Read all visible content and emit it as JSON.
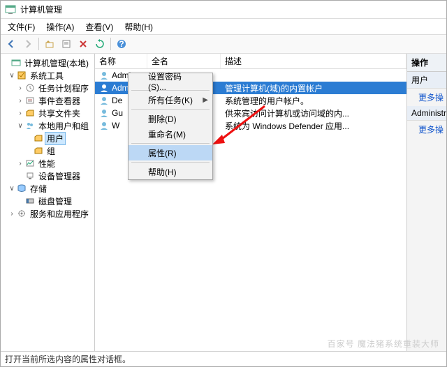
{
  "title": "计算机管理",
  "menus": {
    "file": "文件(F)",
    "action": "操作(A)",
    "view": "查看(V)",
    "help": "帮助(H)"
  },
  "tree": {
    "root": "计算机管理(本地)",
    "systools": "系统工具",
    "scheduler": "任务计划程序",
    "eventviewer": "事件查看器",
    "shared": "共享文件夹",
    "localusers": "本地用户和组",
    "users": "用户",
    "groups": "组",
    "perf": "性能",
    "devmgr": "设备管理器",
    "storage": "存储",
    "diskmgmt": "磁盘管理",
    "services": "服务和应用程序"
  },
  "columns": {
    "name": "名称",
    "fullname": "全名",
    "desc": "描述"
  },
  "colw": {
    "name": 75,
    "fullname": 105,
    "desc": 260
  },
  "users": [
    {
      "name": "Admin",
      "full": "",
      "desc": ""
    },
    {
      "name": "Administrat",
      "full": "",
      "desc": "管理计算机(域)的内置帐户"
    },
    {
      "name": "De",
      "full": "",
      "desc": "系统管理的用户帐户。"
    },
    {
      "name": "Gu",
      "full": "",
      "desc": "供来宾访问计算机或访问域的内..."
    },
    {
      "name": "W",
      "full": "",
      "desc": "系统为 Windows Defender 应用..."
    }
  ],
  "ctx": {
    "setpwd": "设置密码(S)...",
    "alltasks": "所有任务(K)",
    "delete": "删除(D)",
    "rename": "重命名(M)",
    "props": "属性(R)",
    "help": "帮助(H)"
  },
  "actions": {
    "header": "操作",
    "user": "用户",
    "more1": "更多操",
    "selname": "Administrat",
    "more2": "更多操"
  },
  "status": "打开当前所选内容的属性对话框。",
  "watermark": "百家号 魔法猪系统重装大师"
}
